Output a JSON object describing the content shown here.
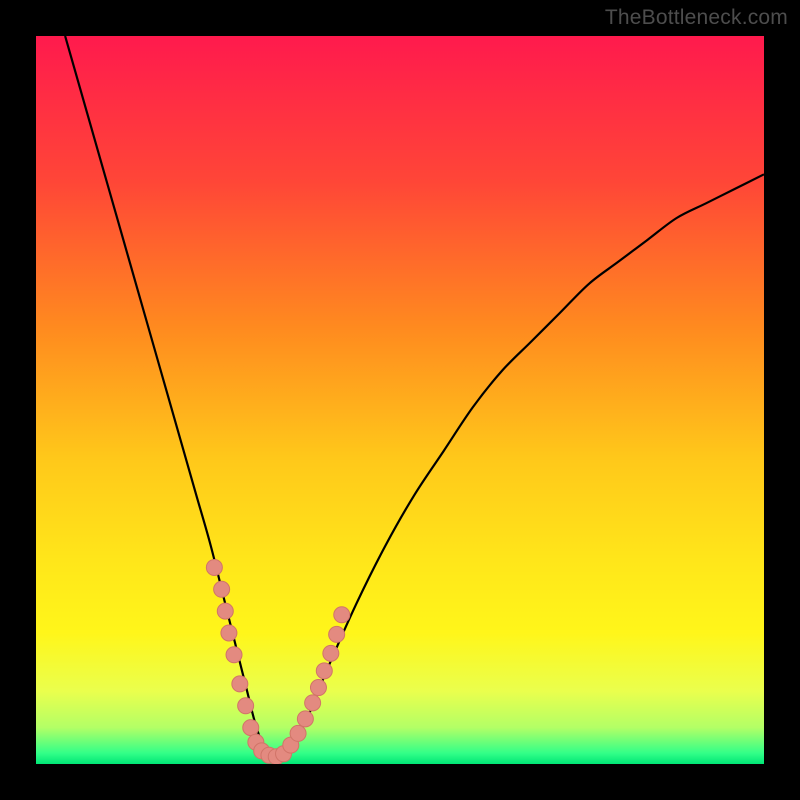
{
  "watermark": {
    "text": "TheBottleneck.com"
  },
  "colors": {
    "frame_bg": "#000000",
    "curve_stroke": "#000000",
    "marker_fill": "#e38a80",
    "marker_stroke": "#d17468",
    "gradient_stops": [
      {
        "offset": 0.0,
        "color": "#ff1a4d"
      },
      {
        "offset": 0.2,
        "color": "#ff4637"
      },
      {
        "offset": 0.4,
        "color": "#ff8a1f"
      },
      {
        "offset": 0.58,
        "color": "#ffc81a"
      },
      {
        "offset": 0.72,
        "color": "#ffe61a"
      },
      {
        "offset": 0.82,
        "color": "#fff61a"
      },
      {
        "offset": 0.9,
        "color": "#eaff4d"
      },
      {
        "offset": 0.95,
        "color": "#b3ff66"
      },
      {
        "offset": 0.985,
        "color": "#33ff88"
      },
      {
        "offset": 1.0,
        "color": "#00e676"
      }
    ]
  },
  "chart_data": {
    "type": "line",
    "title": "",
    "xlabel": "",
    "ylabel": "",
    "xlim": [
      0,
      100
    ],
    "ylim": [
      0,
      100
    ],
    "grid": false,
    "legend": false,
    "series": [
      {
        "name": "bottleneck-curve",
        "x": [
          4,
          6,
          8,
          10,
          12,
          14,
          16,
          18,
          20,
          22,
          24,
          26,
          28,
          29,
          30,
          31,
          32,
          33,
          34,
          36,
          38,
          40,
          44,
          48,
          52,
          56,
          60,
          64,
          68,
          72,
          76,
          80,
          84,
          88,
          92,
          96,
          100
        ],
        "y": [
          100,
          93,
          86,
          79,
          72,
          65,
          58,
          51,
          44,
          37,
          30,
          22,
          14,
          10,
          6,
          3,
          1.5,
          1,
          1.5,
          4,
          8,
          13,
          22,
          30,
          37,
          43,
          49,
          54,
          58,
          62,
          66,
          69,
          72,
          75,
          77,
          79,
          81
        ]
      }
    ],
    "markers": {
      "name": "highlighted-points",
      "x": [
        24.5,
        25.5,
        26.0,
        26.5,
        27.2,
        28.0,
        28.8,
        29.5,
        30.2,
        31.0,
        32.0,
        33.0,
        34.0,
        35.0,
        36.0,
        37.0,
        38.0,
        38.8,
        39.6,
        40.5,
        41.3,
        42.0
      ],
      "y": [
        27.0,
        24.0,
        21.0,
        18.0,
        15.0,
        11.0,
        8.0,
        5.0,
        3.0,
        1.8,
        1.2,
        1.0,
        1.4,
        2.6,
        4.2,
        6.2,
        8.4,
        10.5,
        12.8,
        15.2,
        17.8,
        20.5
      ]
    }
  }
}
